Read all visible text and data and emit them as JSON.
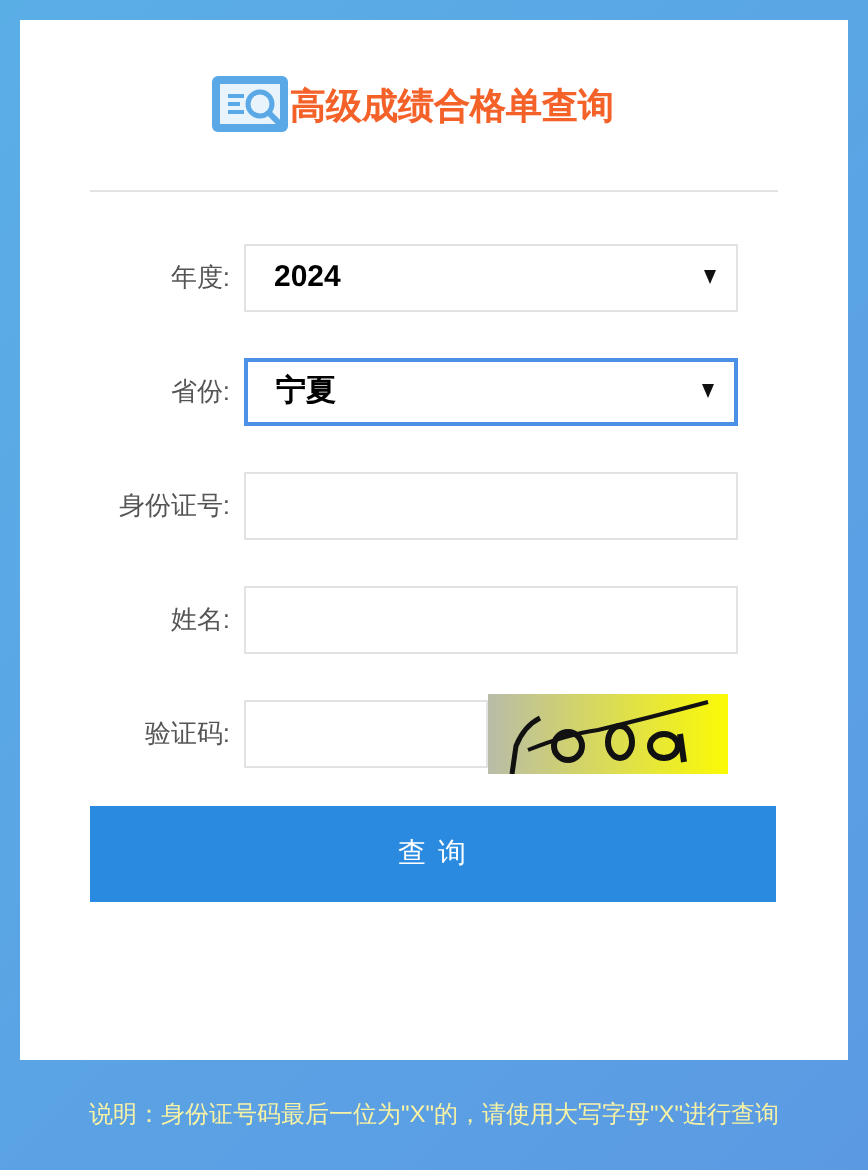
{
  "title": "高级成绩合格单查询",
  "fields": [
    {
      "kind": "select",
      "label": "年度:",
      "value": "2024",
      "focused": false
    },
    {
      "kind": "select",
      "label": "省份:",
      "value": "宁夏",
      "focused": true
    },
    {
      "kind": "text",
      "label": "身份证号:",
      "focused": false
    },
    {
      "kind": "text",
      "label": "姓名:",
      "focused": false
    },
    {
      "kind": "captcha",
      "label": "验证码:",
      "focused": false
    }
  ],
  "submit": "查 询",
  "note": "说明：身份证号码最后一位为\"X\"的，请使用大写字母\"X\"进行查询"
}
